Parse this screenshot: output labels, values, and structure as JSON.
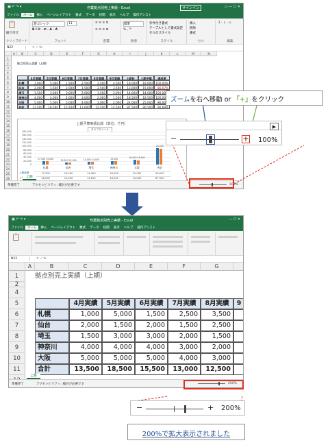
{
  "top": {
    "window_title": "作業拠点別売上実績 - Excel",
    "signin": "サインイン",
    "tabs": [
      "ファイル",
      "ホーム",
      "挿入",
      "ページレイアウト",
      "数式",
      "データ",
      "校閲",
      "表示",
      "ヘルプ",
      "操作アシスト"
    ],
    "ribbon": {
      "paste": "貼り付け",
      "clipboard": "クリップボード",
      "font_name": "游ゴシック",
      "font_size": "11",
      "font_group": "フォント",
      "align_group": "配置",
      "number_fmt": "標準",
      "number_group": "数値",
      "cond_fmt": "条件付き書式",
      "table_fmt": "テーブルとして書式設定",
      "cell_style": "セルのスタイル",
      "style_group": "スタイル",
      "insert": "挿入",
      "delete": "削除",
      "format": "書式",
      "cells_group": "セル",
      "edit_group": "編集"
    },
    "name_box": "N22",
    "sheet_title": "拠点別売上実績（上期）",
    "table": {
      "headers": [
        "",
        "4月実績",
        "5月実績",
        "6月実績",
        "7月実績",
        "8月実績",
        "9月実績",
        "上期計",
        "上期予算",
        "達成率"
      ],
      "rows": [
        [
          "札幌",
          "1,000",
          "5,000",
          "1,500",
          "2,500",
          "3,500",
          "4,500",
          "18,000",
          "18,000",
          "100.00%"
        ],
        [
          "仙台",
          "2,000",
          "1,500",
          "2,000",
          "1,500",
          "2,500",
          "3,500",
          "13,000",
          "15,000",
          "86.67%"
        ],
        [
          "埼玉",
          "1,500",
          "3,000",
          "3,000",
          "2,000",
          "1,500",
          "3,000",
          "14,000",
          "14,000",
          "100.00%"
        ],
        [
          "神奈川",
          "4,000",
          "4,000",
          "4,000",
          "3,000",
          "2,000",
          "1,500",
          "18,500",
          "18,500",
          "100.00%"
        ],
        [
          "大阪",
          "5,000",
          "5,000",
          "5,000",
          "4,000",
          "3,000",
          "2,000",
          "24,000",
          "25,000",
          "96.00%"
        ],
        [
          "合計",
          "13,500",
          "18,500",
          "15,500",
          "13,000",
          "12,500",
          "14,500",
          "87,500",
          "90,500",
          "96.69%"
        ]
      ]
    },
    "chart": {
      "title": "上期予算実績比較（単位：千円）",
      "subtitle": "グラフタイトル",
      "y_ticks": [
        "180,000",
        "160,000",
        "140,000",
        "120,000",
        "100,000",
        "80,000",
        "60,000",
        "40,000",
        "20,000",
        "0"
      ],
      "labels": [
        "17,500 15,000",
        "13,000 12,500",
        "14,000 14,000",
        "15,000",
        "18,500 18,500",
        "24,000"
      ],
      "categories": [
        "札幌",
        "仙台",
        "埼玉",
        "神奈川",
        "大阪",
        "合計"
      ],
      "legend_actual": "上期実績",
      "legend_budget": "上期予算",
      "budget_vals": [
        "17,500",
        "13,000",
        "14,000",
        "18,500",
        "25,000",
        "90,500"
      ],
      "actual_vals": [
        "18,000",
        "13,000",
        "14,000",
        "18,500",
        "24,000",
        "87,500"
      ]
    },
    "sheet_tab": "上期",
    "status_left": "準備完了",
    "status_access": "アクセシビリティ: 検討が必要です",
    "zoom_small": "100%",
    "callout_part1": "ズーム",
    "callout_part2": "を右へ移動 or ",
    "callout_part3": "「+」",
    "callout_part4": "をクリック",
    "zoom_big": "100%"
  },
  "arrow_color": "#2f5597",
  "bottom": {
    "window_title": "作業拠点別売上実績 - Excel",
    "tabs": [
      "ファイル",
      "ホーム",
      "挿入",
      "ページレイアウト",
      "数式",
      "データ",
      "校閲",
      "表示",
      "ヘルプ",
      "操作アシスト"
    ],
    "name_box": "N22",
    "col_letters": [
      "A",
      "B",
      "C",
      "D",
      "E",
      "F",
      "G"
    ],
    "row_numbers": [
      "1",
      "2",
      "4",
      "5",
      "6",
      "7",
      "8",
      "9",
      "10",
      "11",
      "12",
      "13"
    ],
    "sheet_title": "拠点別売上実績（上期）",
    "headers": [
      "4月実績",
      "5月実績",
      "6月実績",
      "7月実績",
      "8月実績",
      "9"
    ],
    "rows": [
      [
        "札幌",
        "1,000",
        "5,000",
        "1,500",
        "2,500",
        "3,500"
      ],
      [
        "仙台",
        "2,000",
        "1,500",
        "2,000",
        "1,500",
        "2,500"
      ],
      [
        "埼玉",
        "1,500",
        "3,000",
        "3,000",
        "2,000",
        "1,500"
      ],
      [
        "神奈川",
        "4,000",
        "4,000",
        "4,000",
        "3,000",
        "2,000"
      ],
      [
        "大阪",
        "5,000",
        "5,000",
        "5,000",
        "4,000",
        "3,000"
      ],
      [
        "合計",
        "13,500",
        "18,500",
        "15,500",
        "13,000",
        "12,500"
      ]
    ],
    "sheet_tab": "上期",
    "status_left": "準備完了",
    "status_access": "アクセシビリティ: 検討が必要です",
    "zoom_small": "200%",
    "zoom_big": "200%",
    "caption": "200%で拡大表示されました"
  }
}
